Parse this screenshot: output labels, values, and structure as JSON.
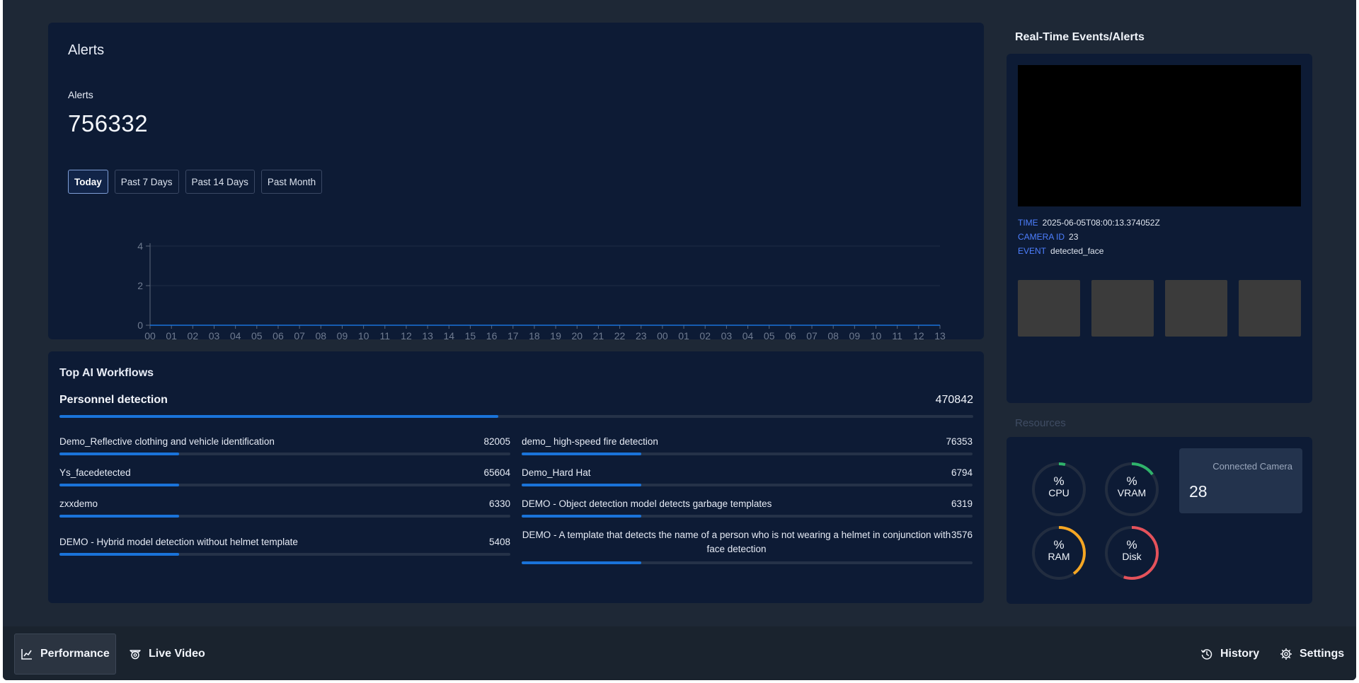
{
  "alerts": {
    "card_title": "Alerts",
    "subtitle": "Alerts",
    "count": "756332",
    "ranges": [
      "Today",
      "Past 7 Days",
      "Past 14 Days",
      "Past Month"
    ],
    "active_range": "Today"
  },
  "chart_data": {
    "type": "line",
    "x": [
      "00",
      "01",
      "02",
      "03",
      "04",
      "05",
      "06",
      "07",
      "08",
      "09",
      "10",
      "11",
      "12",
      "13",
      "14",
      "15",
      "16",
      "17",
      "18",
      "19",
      "20",
      "21",
      "22",
      "23",
      "00",
      "01",
      "02",
      "03",
      "04",
      "05",
      "06",
      "07",
      "08",
      "09",
      "10",
      "11",
      "12",
      "13"
    ],
    "series": [
      {
        "values": [
          0,
          0,
          0,
          0,
          0,
          0,
          0,
          0,
          0,
          0,
          0,
          0,
          0,
          0,
          0,
          0,
          0,
          0,
          0,
          0,
          0,
          0,
          0,
          0,
          0,
          0,
          0,
          0,
          0,
          0,
          0,
          0,
          0,
          0,
          0,
          0,
          0,
          0
        ]
      }
    ],
    "yticks": [
      0,
      2,
      4
    ],
    "ylim": [
      0,
      4
    ],
    "grid": true
  },
  "workflows": {
    "title": "Top AI Workflows",
    "top": {
      "name": "Personnel detection",
      "value": "470842",
      "fraction": 0.48
    },
    "items": [
      {
        "name": "Demo_Reflective clothing and vehicle identification",
        "value": "82005",
        "fraction": 0.265
      },
      {
        "name": "demo_ high-speed fire detection",
        "value": "76353",
        "fraction": 0.265
      },
      {
        "name": "Ys_facedetected",
        "value": "65604",
        "fraction": 0.265
      },
      {
        "name": "Demo_Hard Hat",
        "value": "6794",
        "fraction": 0.265
      },
      {
        "name": "zxxdemo",
        "value": "6330",
        "fraction": 0.265
      },
      {
        "name": "DEMO - Object detection model detects garbage templates",
        "value": "6319",
        "fraction": 0.265
      },
      {
        "name": "DEMO - Hybrid model detection without helmet template",
        "value": "5408",
        "fraction": 0.265
      },
      {
        "name": "DEMO - A template that detects the name of a person who is not wearing a helmet in conjunction with face detection",
        "value": "3576",
        "fraction": 0.265
      }
    ]
  },
  "realtime": {
    "title": "Real-Time Events/Alerts",
    "time_label": "TIME",
    "time_value": "2025-06-05T08:00:13.374052Z",
    "camera_label": "CAMERA ID",
    "camera_value": "23",
    "event_label": "EVENT",
    "event_value": "detected_face"
  },
  "resources": {
    "title": "Resources",
    "gauges": [
      {
        "symbol": "%",
        "label": "CPU",
        "fraction": 0.04,
        "color": "#2fb36b"
      },
      {
        "symbol": "%",
        "label": "VRAM",
        "fraction": 0.15,
        "color": "#2fb36b"
      },
      {
        "symbol": "%",
        "label": "RAM",
        "fraction": 0.4,
        "color": "#f5a623"
      },
      {
        "symbol": "%",
        "label": "Disk",
        "fraction": 0.55,
        "color": "#e5525b"
      }
    ],
    "camera_box_label": "Connected Camera",
    "camera_count": "28"
  },
  "nav": {
    "performance": "Performance",
    "live_video": "Live Video",
    "history": "History",
    "settings": "Settings"
  },
  "colors": {
    "accent": "#1a73d9",
    "background": "#1e2836",
    "card": "#0d1b35"
  }
}
